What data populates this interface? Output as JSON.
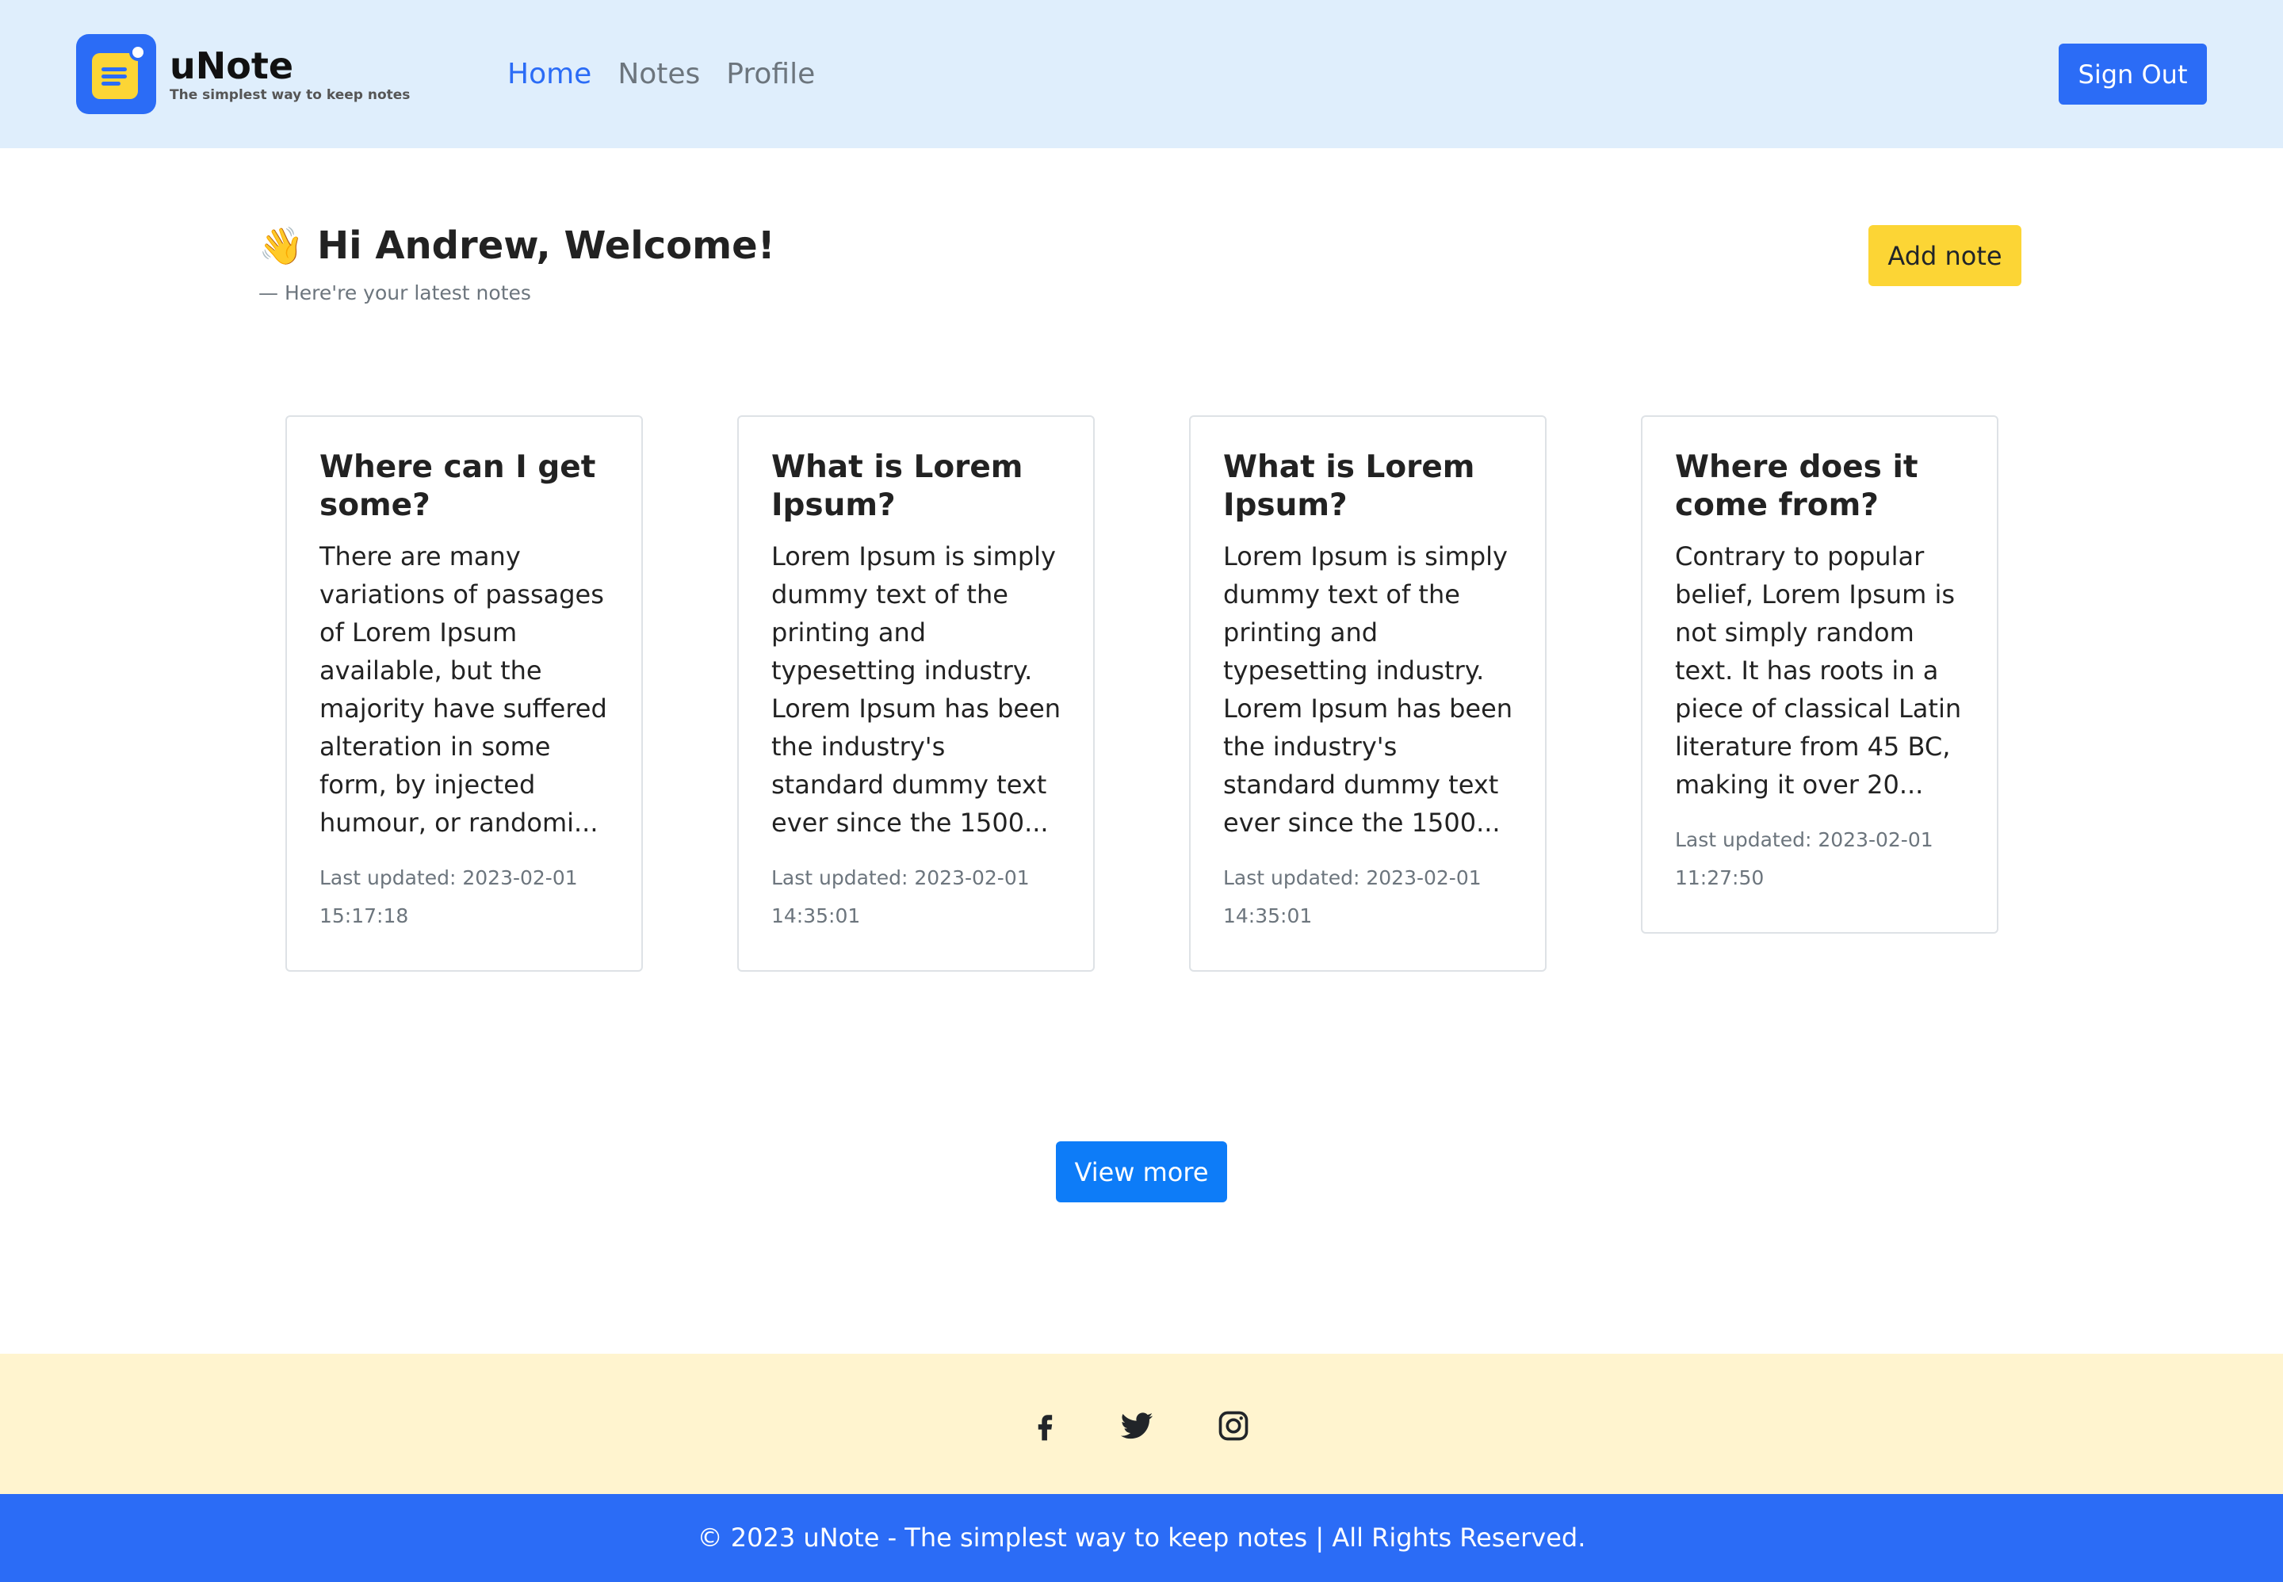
{
  "app": {
    "name": "uNote",
    "tagline": "The simplest way to keep notes"
  },
  "nav": {
    "items": [
      {
        "label": "Home",
        "active": true
      },
      {
        "label": "Notes",
        "active": false
      },
      {
        "label": "Profile",
        "active": false
      }
    ],
    "sign_out_label": "Sign Out"
  },
  "welcome": {
    "wave_emoji": "👋",
    "title": "Hi Andrew, Welcome!",
    "subtitle": "— Here're your latest notes",
    "add_note_label": "Add note"
  },
  "notes": [
    {
      "title": "Where can I get some?",
      "body": "There are many variations of passages of Lorem Ipsum available, but the majority have suffered alteration in some form, by injected humour, or randomi...",
      "updated": "Last updated: 2023-02-01 15:17:18"
    },
    {
      "title": "What is Lorem Ipsum?",
      "body": "Lorem Ipsum is simply dummy text of the printing and typesetting industry. Lorem Ipsum has been the industry's standard dummy text ever since the 1500...",
      "updated": "Last updated: 2023-02-01 14:35:01"
    },
    {
      "title": "What is Lorem Ipsum?",
      "body": "Lorem Ipsum is simply dummy text of the printing and typesetting industry. Lorem Ipsum has been the industry's standard dummy text ever since the 1500...",
      "updated": "Last updated: 2023-02-01 14:35:01"
    },
    {
      "title": "Where does it come from?",
      "body": "Contrary to popular belief, Lorem Ipsum is not simply random text. It has roots in a piece of classical Latin literature from 45 BC, making it over 20...",
      "updated": "Last updated: 2023-02-01 11:27:50"
    }
  ],
  "view_more_label": "View more",
  "footer": {
    "social_icons": [
      "facebook-icon",
      "twitter-icon",
      "instagram-icon"
    ],
    "copyright": "© 2023 uNote - The simplest way to keep notes | All Rights Reserved."
  },
  "colors": {
    "primary": "#2b6cf6",
    "accent_yellow": "#fcd535",
    "header_bg": "#dfeefc",
    "footer_social_bg": "#fff4cf",
    "view_more_blue": "#0d7cf8"
  }
}
